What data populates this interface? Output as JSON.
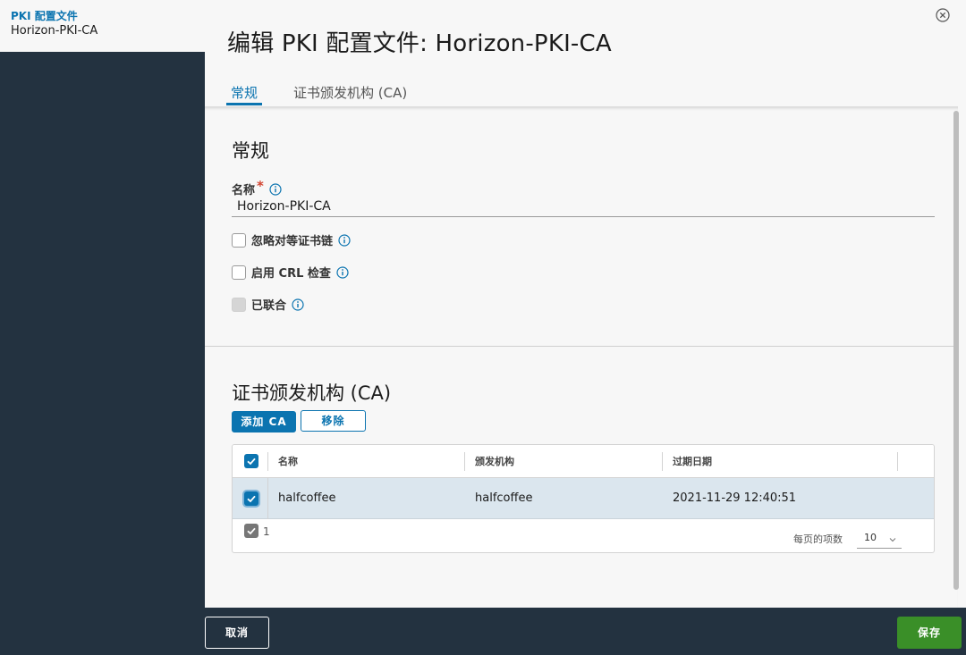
{
  "sidebar": {
    "breadcrumb_title": "PKI 配置文件",
    "breadcrumb_subtitle": "Horizon-PKI-CA"
  },
  "header": {
    "title": "编辑 PKI 配置文件: Horizon-PKI-CA",
    "close_icon": "close-circle-icon"
  },
  "tabs": [
    {
      "label": "常规",
      "active": true
    },
    {
      "label": "证书颁发机构 (CA)",
      "active": false
    }
  ],
  "general": {
    "section_title": "常规",
    "name_label": "名称",
    "name_required_mark": "*",
    "name_value": "Horizon-PKI-CA",
    "checkboxes": [
      {
        "label": "忽略对等证书链",
        "checked": false,
        "disabled": false
      },
      {
        "label": "启用 CRL 检查",
        "checked": false,
        "disabled": false
      },
      {
        "label": "已联合",
        "checked": false,
        "disabled": true
      }
    ]
  },
  "ca": {
    "section_title": "证书颁发机构 (CA)",
    "add_button": "添加 CA",
    "remove_button": "移除",
    "columns": [
      "名称",
      "颁发机构",
      "过期日期"
    ],
    "rows": [
      {
        "name": "halfcoffee",
        "issuer": "halfcoffee",
        "expiry": "2021-11-29 12:40:51",
        "selected": true
      }
    ],
    "selected_count": "1",
    "page_size_label": "每页的项数",
    "page_size_value": "10"
  },
  "footer": {
    "cancel_button": "取消",
    "save_button": "保存"
  },
  "colors": {
    "accent": "#0b74b0",
    "sidebar_bg": "#233240",
    "save_green": "#3a8f28",
    "selected_row": "#dbe6ee",
    "required": "#d2432f"
  }
}
